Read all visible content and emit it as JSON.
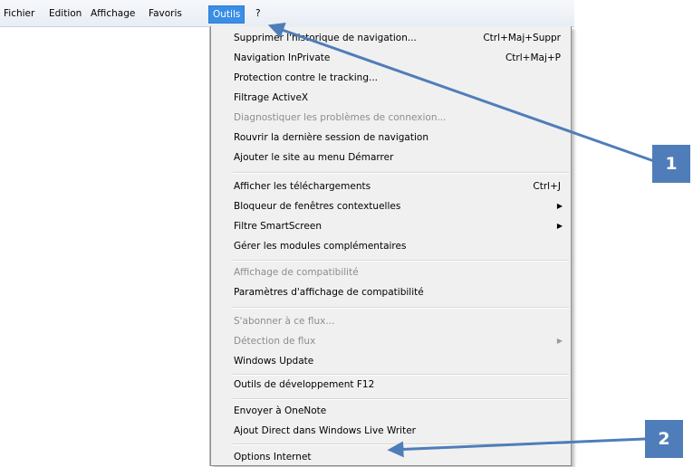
{
  "menubar": {
    "items": [
      "Fichier",
      "Edition",
      "Affichage",
      "Favoris",
      "Outils",
      "?"
    ]
  },
  "menu": {
    "items": [
      {
        "label": "Supprimer l'historique de navigation...",
        "shortcut": "Ctrl+Maj+Suppr"
      },
      {
        "label": "Navigation InPrivate",
        "shortcut": "Ctrl+Maj+P"
      },
      {
        "label": "Protection contre le tracking..."
      },
      {
        "label": "Filtrage ActiveX"
      },
      {
        "label": "Diagnostiquer les problèmes de connexion...",
        "disabled": true
      },
      {
        "label": "Rouvrir la dernière session de navigation"
      },
      {
        "label": "Ajouter le site au menu Démarrer"
      },
      {
        "label": "Afficher les téléchargements",
        "shortcut": "Ctrl+J"
      },
      {
        "label": "Bloqueur de fenêtres contextuelles",
        "submenu": true
      },
      {
        "label": "Filtre SmartScreen",
        "submenu": true
      },
      {
        "label": "Gérer les modules complémentaires"
      },
      {
        "label": "Affichage de compatibilité",
        "disabled": true
      },
      {
        "label": "Paramètres d'affichage de compatibilité"
      },
      {
        "label": "S'abonner à ce flux...",
        "disabled": true
      },
      {
        "label": "Détection de flux",
        "disabled": true,
        "submenu": true
      },
      {
        "label": "Windows Update"
      },
      {
        "label": "Outils de développement F12"
      },
      {
        "label": "Envoyer à OneNote"
      },
      {
        "label": "Ajout Direct dans Windows Live Writer"
      },
      {
        "label": "Options Internet"
      }
    ]
  },
  "callouts": {
    "one": "1",
    "two": "2"
  },
  "colors": {
    "accent": "#3a8ee6",
    "callout": "#4f7db9"
  }
}
